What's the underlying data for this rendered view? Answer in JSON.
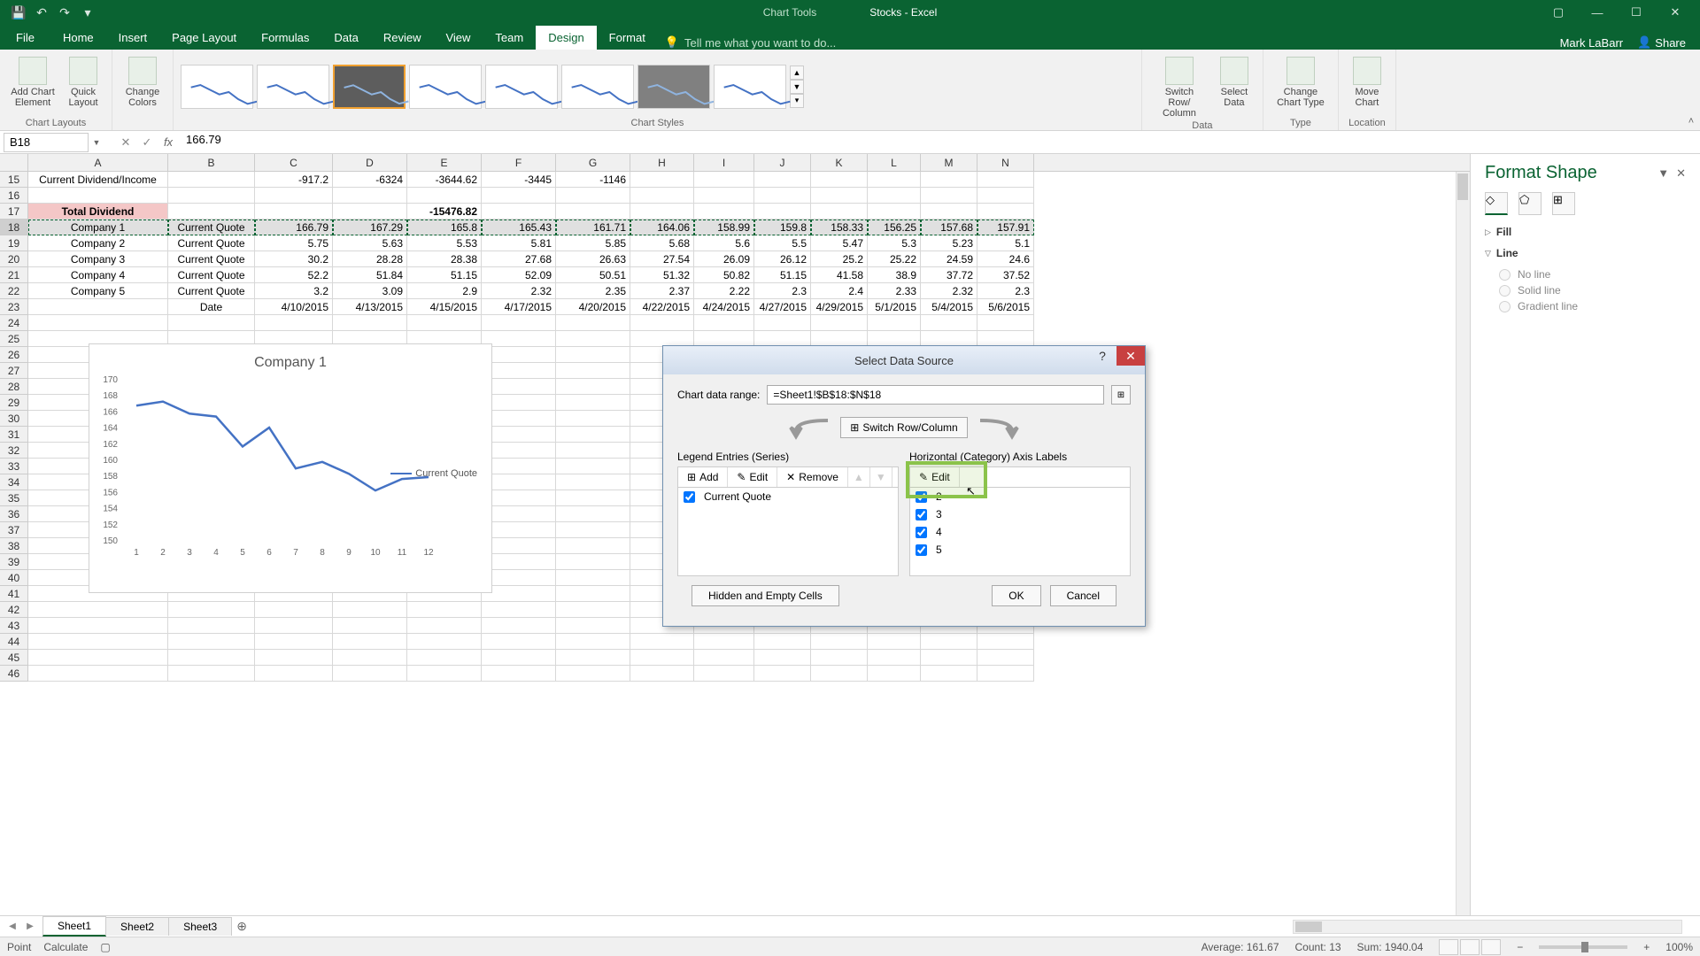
{
  "titlebar": {
    "chart_tools": "Chart Tools",
    "title": "Stocks - Excel"
  },
  "ribbon_tabs": {
    "file": "File",
    "home": "Home",
    "insert": "Insert",
    "page_layout": "Page Layout",
    "formulas": "Formulas",
    "data": "Data",
    "review": "Review",
    "view": "View",
    "team": "Team",
    "design": "Design",
    "format": "Format",
    "tell_me": "Tell me what you want to do...",
    "user": "Mark LaBarr",
    "share": "Share"
  },
  "ribbon": {
    "add_chart_element": "Add Chart Element",
    "quick_layout": "Quick Layout",
    "change_colors": "Change Colors",
    "chart_layouts_label": "Chart Layouts",
    "chart_styles_label": "Chart Styles",
    "switch_row_col": "Switch Row/ Column",
    "select_data": "Select Data",
    "data_label": "Data",
    "change_chart_type": "Change Chart Type",
    "type_label": "Type",
    "move_chart": "Move Chart",
    "location_label": "Location"
  },
  "formula": {
    "name_box": "B18",
    "value": "166.79"
  },
  "columns": [
    "A",
    "B",
    "C",
    "D",
    "E",
    "F",
    "G",
    "H",
    "I",
    "J",
    "K",
    "L",
    "M",
    "N"
  ],
  "rows": [
    {
      "num": 15,
      "cells": [
        "Current Dividend/Income",
        "",
        "-917.2",
        "-6324",
        "-3644.62",
        "-3445",
        "-1146",
        "",
        "",
        "",
        "",
        "",
        "",
        ""
      ]
    },
    {
      "num": 16,
      "cells": [
        "",
        "",
        "",
        "",
        "",
        "",
        "",
        "",
        "",
        "",
        "",
        "",
        "",
        ""
      ]
    },
    {
      "num": 17,
      "cells": [
        "Total Dividend",
        "",
        "",
        "",
        "-15476.82",
        "",
        "",
        "",
        "",
        "",
        "",
        "",
        "",
        ""
      ]
    },
    {
      "num": 18,
      "cells": [
        "Company 1",
        "Current Quote",
        "166.79",
        "167.29",
        "165.8",
        "165.43",
        "161.71",
        "164.06",
        "158.99",
        "159.8",
        "158.33",
        "156.25",
        "157.68",
        "157.91"
      ]
    },
    {
      "num": 19,
      "cells": [
        "Company 2",
        "Current Quote",
        "5.75",
        "5.63",
        "5.53",
        "5.81",
        "5.85",
        "5.68",
        "5.6",
        "5.5",
        "5.47",
        "5.3",
        "5.23",
        "5.1"
      ]
    },
    {
      "num": 20,
      "cells": [
        "Company 3",
        "Current Quote",
        "30.2",
        "28.28",
        "28.38",
        "27.68",
        "26.63",
        "27.54",
        "26.09",
        "26.12",
        "25.2",
        "25.22",
        "24.59",
        "24.6"
      ]
    },
    {
      "num": 21,
      "cells": [
        "Company 4",
        "Current Quote",
        "52.2",
        "51.84",
        "51.15",
        "52.09",
        "50.51",
        "51.32",
        "50.82",
        "51.15",
        "41.58",
        "38.9",
        "37.72",
        "37.52"
      ]
    },
    {
      "num": 22,
      "cells": [
        "Company 5",
        "Current Quote",
        "3.2",
        "3.09",
        "2.9",
        "2.32",
        "2.35",
        "2.37",
        "2.22",
        "2.3",
        "2.4",
        "2.33",
        "2.32",
        "2.3"
      ]
    },
    {
      "num": 23,
      "cells": [
        "",
        "Date",
        "4/10/2015",
        "4/13/2015",
        "4/15/2015",
        "4/17/2015",
        "4/20/2015",
        "4/22/2015",
        "4/24/2015",
        "4/27/2015",
        "4/29/2015",
        "5/1/2015",
        "5/4/2015",
        "5/6/2015"
      ]
    }
  ],
  "empty_rows": [
    24,
    25,
    26,
    27,
    28,
    29,
    30,
    31,
    32,
    33,
    34,
    35,
    36,
    37,
    38,
    39,
    40,
    41,
    42,
    43,
    44,
    45,
    46
  ],
  "chart_data": {
    "type": "line",
    "title": "Company 1",
    "series": [
      {
        "name": "Current Quote",
        "values": [
          166.79,
          167.29,
          165.8,
          165.43,
          161.71,
          164.06,
          158.99,
          159.8,
          158.33,
          156.25,
          157.68,
          157.91
        ]
      }
    ],
    "categories": [
      "1",
      "2",
      "3",
      "4",
      "5",
      "6",
      "7",
      "8",
      "9",
      "10",
      "11",
      "12"
    ],
    "ylim": [
      150,
      170
    ],
    "yticks": [
      150,
      152,
      154,
      156,
      158,
      160,
      162,
      164,
      166,
      168,
      170
    ],
    "xlabel": "",
    "ylabel": ""
  },
  "dialog": {
    "title": "Select Data Source",
    "range_label": "Chart data range:",
    "range_value": "=Sheet1!$B$18:$N$18",
    "switch": "Switch Row/Column",
    "legend_label": "Legend Entries (Series)",
    "add": "Add",
    "edit": "Edit",
    "remove": "Remove",
    "legend_items": [
      "Current Quote"
    ],
    "axis_label": "Horizontal (Category) Axis Labels",
    "axis_edit": "Edit",
    "axis_items": [
      "2",
      "3",
      "4",
      "5"
    ],
    "hidden_cells": "Hidden and Empty Cells",
    "ok": "OK",
    "cancel": "Cancel"
  },
  "format_pane": {
    "title": "Format Shape",
    "fill": "Fill",
    "line": "Line",
    "no_line": "No line",
    "solid_line": "Solid line",
    "gradient_line": "Gradient line"
  },
  "sheets": {
    "s1": "Sheet1",
    "s2": "Sheet2",
    "s3": "Sheet3"
  },
  "statusbar": {
    "point": "Point",
    "calculate": "Calculate",
    "average": "Average: 161.67",
    "count": "Count: 13",
    "sum": "Sum: 1940.04",
    "zoom": "100%"
  }
}
